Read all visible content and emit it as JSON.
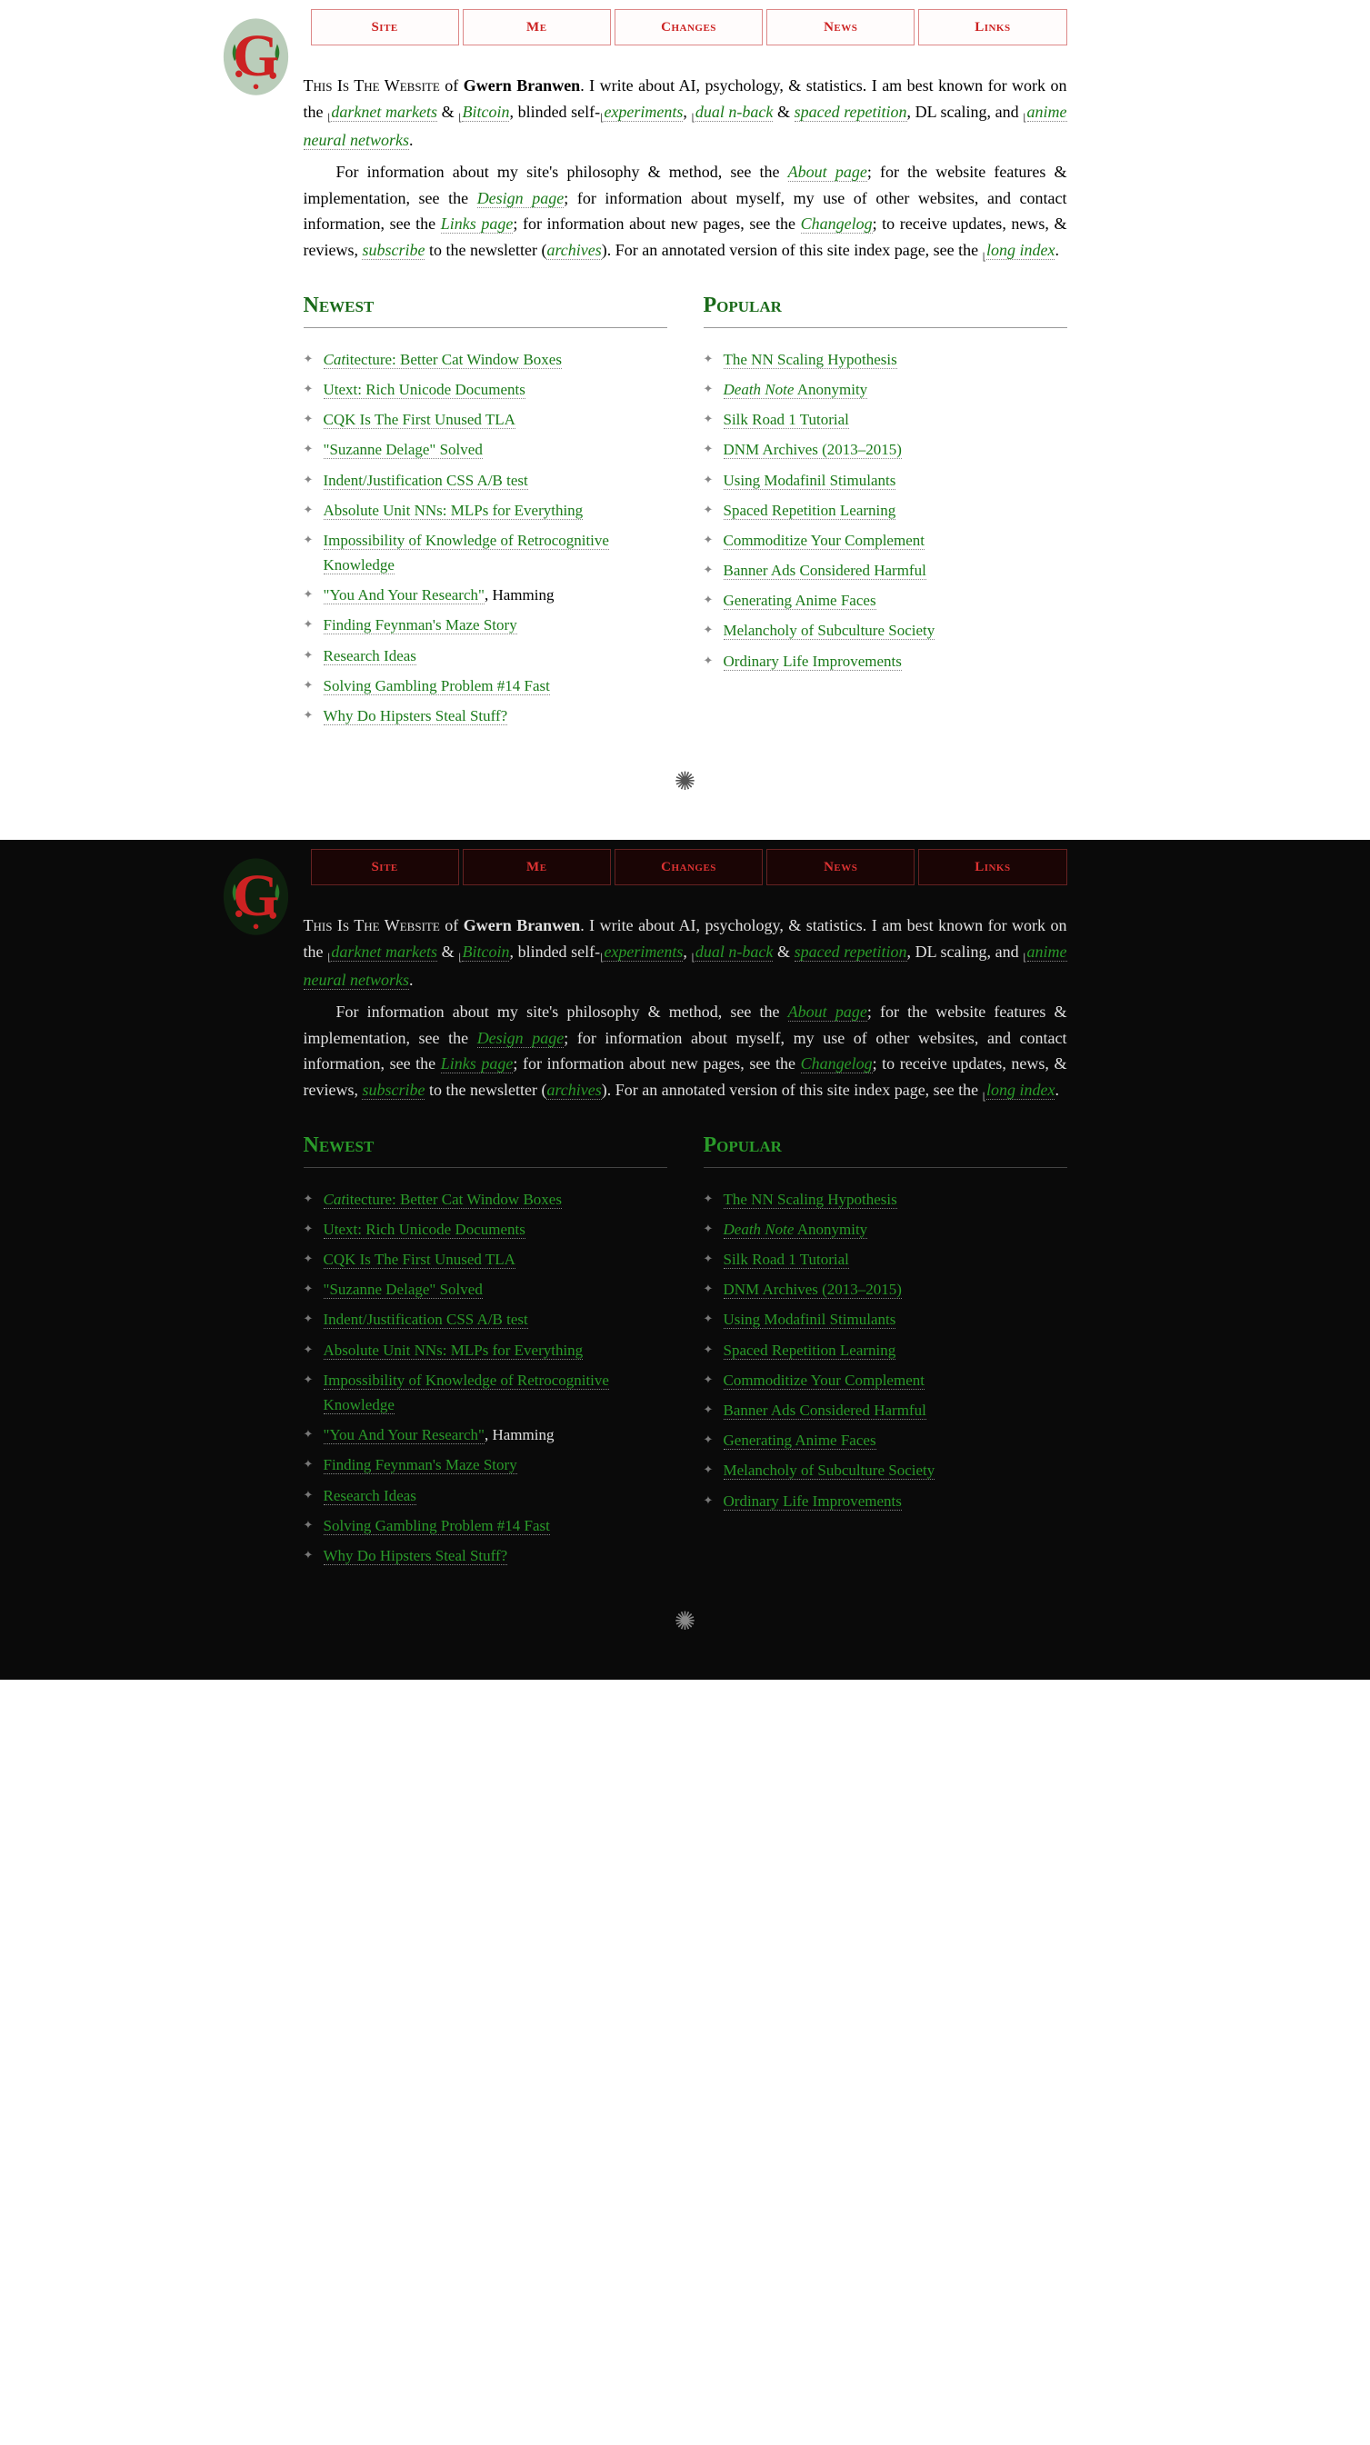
{
  "nav": [
    "Site",
    "Me",
    "Changes",
    "News",
    "Links"
  ],
  "intro": {
    "lead": "This Is The Website",
    "of": " of ",
    "author": "Gwern Branwen",
    "p1a": ". I write about AI, psychology, & statistics. I am best known for work on the ",
    "darknet": "darknet markets",
    "amp": " & ",
    "bitcoin": "Bitcoin",
    "p1b": ", blinded self-",
    "experiments": "experiments",
    "p1c": ", ",
    "dualn": "dual n-back",
    "p1d": " & ",
    "spaced": "spaced repetition",
    "p1e": ", DL scaling, and ",
    "anime": "anime neural networks",
    "p1f": ".",
    "p2a": "For information about my site's philosophy & method, see the ",
    "about": "About page",
    "p2b": "; for the website features & implementation, see the ",
    "design": "Design page",
    "p2c": "; for information about myself, my use of other websites, and contact information, see the ",
    "links": "Links page",
    "p2d": "; for information about new pages, see the ",
    "changelog": "Changelog",
    "p2e": "; to receive updates, news, & reviews, ",
    "subscribe": "subscribe",
    "p2f": " to the newsletter (",
    "archives": "archives",
    "p2g": "). For an annotated version of this site index page, see the ",
    "longindex": "long index",
    "p2h": "."
  },
  "newest_title": "Newest",
  "popular_title": "Popular",
  "newest": [
    {
      "pre": "Cat",
      "text": "itecture: Better Cat Window Boxes"
    },
    {
      "text": "Utext: Rich Unicode Documents"
    },
    {
      "text": "CQK Is The First Unused TLA"
    },
    {
      "text": "\"Suzanne Delage\" Solved"
    },
    {
      "text": "Indent/Justification CSS A/B test"
    },
    {
      "text": "Absolute Unit NNs: MLPs for Everything"
    },
    {
      "text": "Impossibility of Knowledge of Retrocognitive Knowledge"
    },
    {
      "text": "\"You And Your Research\"",
      "suffix": ", Hamming"
    },
    {
      "text": "Finding Feynman's Maze Story"
    },
    {
      "text": "Research Ideas"
    },
    {
      "text": "Solving Gambling Problem #14 Fast"
    },
    {
      "text": "Why Do Hipsters Steal Stuff?"
    }
  ],
  "popular": [
    {
      "text": "The NN Scaling Hypothesis"
    },
    {
      "pre": "Death Note",
      "text": " Anonymity"
    },
    {
      "text": "Silk Road 1 Tutorial"
    },
    {
      "text": "DNM Archives (2013–2015)"
    },
    {
      "text": "Using Modafinil Stimulants"
    },
    {
      "text": "Spaced Repetition Learning"
    },
    {
      "text": "Commoditize Your Complement"
    },
    {
      "text": "Banner Ads Considered Harmful"
    },
    {
      "text": "Generating Anime Faces"
    },
    {
      "text": "Melancholy of Subculture Society"
    },
    {
      "text": "Ordinary Life Improvements"
    }
  ],
  "divider": "✺"
}
